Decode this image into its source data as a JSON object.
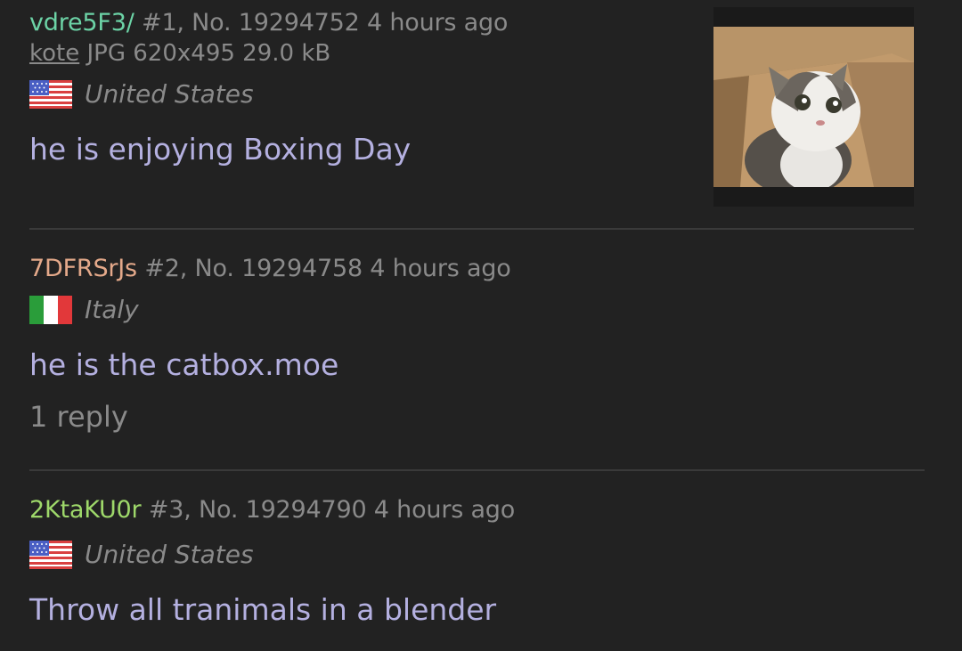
{
  "posts": [
    {
      "uid": "vdre5F3/",
      "uid_color": "#6cd3a6",
      "meta": "#1, No. 19294752 4 hours ago",
      "file": {
        "name": "kote",
        "info": "JPG 620x495 29.0 kB"
      },
      "country": "United States",
      "flag": "us-flag-icon",
      "text": "he is enjoying Boxing Day"
    },
    {
      "uid": "7DFRSrJs",
      "uid_color": "#e4a98a",
      "meta": "#2, No. 19294758 4 hours ago",
      "country": "Italy",
      "flag": "it-flag-icon",
      "text": "he is the catbox.moe",
      "replies": "1 reply"
    },
    {
      "uid": "2KtaKU0r",
      "uid_color": "#9ed86a",
      "meta": "#3, No. 19294790 4 hours ago",
      "country": "United States",
      "flag": "us-flag-icon",
      "text": "Throw all tranimals in a blender"
    }
  ],
  "colors": {
    "background": "#222222",
    "body_text": "#b4b0e0",
    "meta_text": "#8a8a8a",
    "divider": "#3a3a3a"
  }
}
